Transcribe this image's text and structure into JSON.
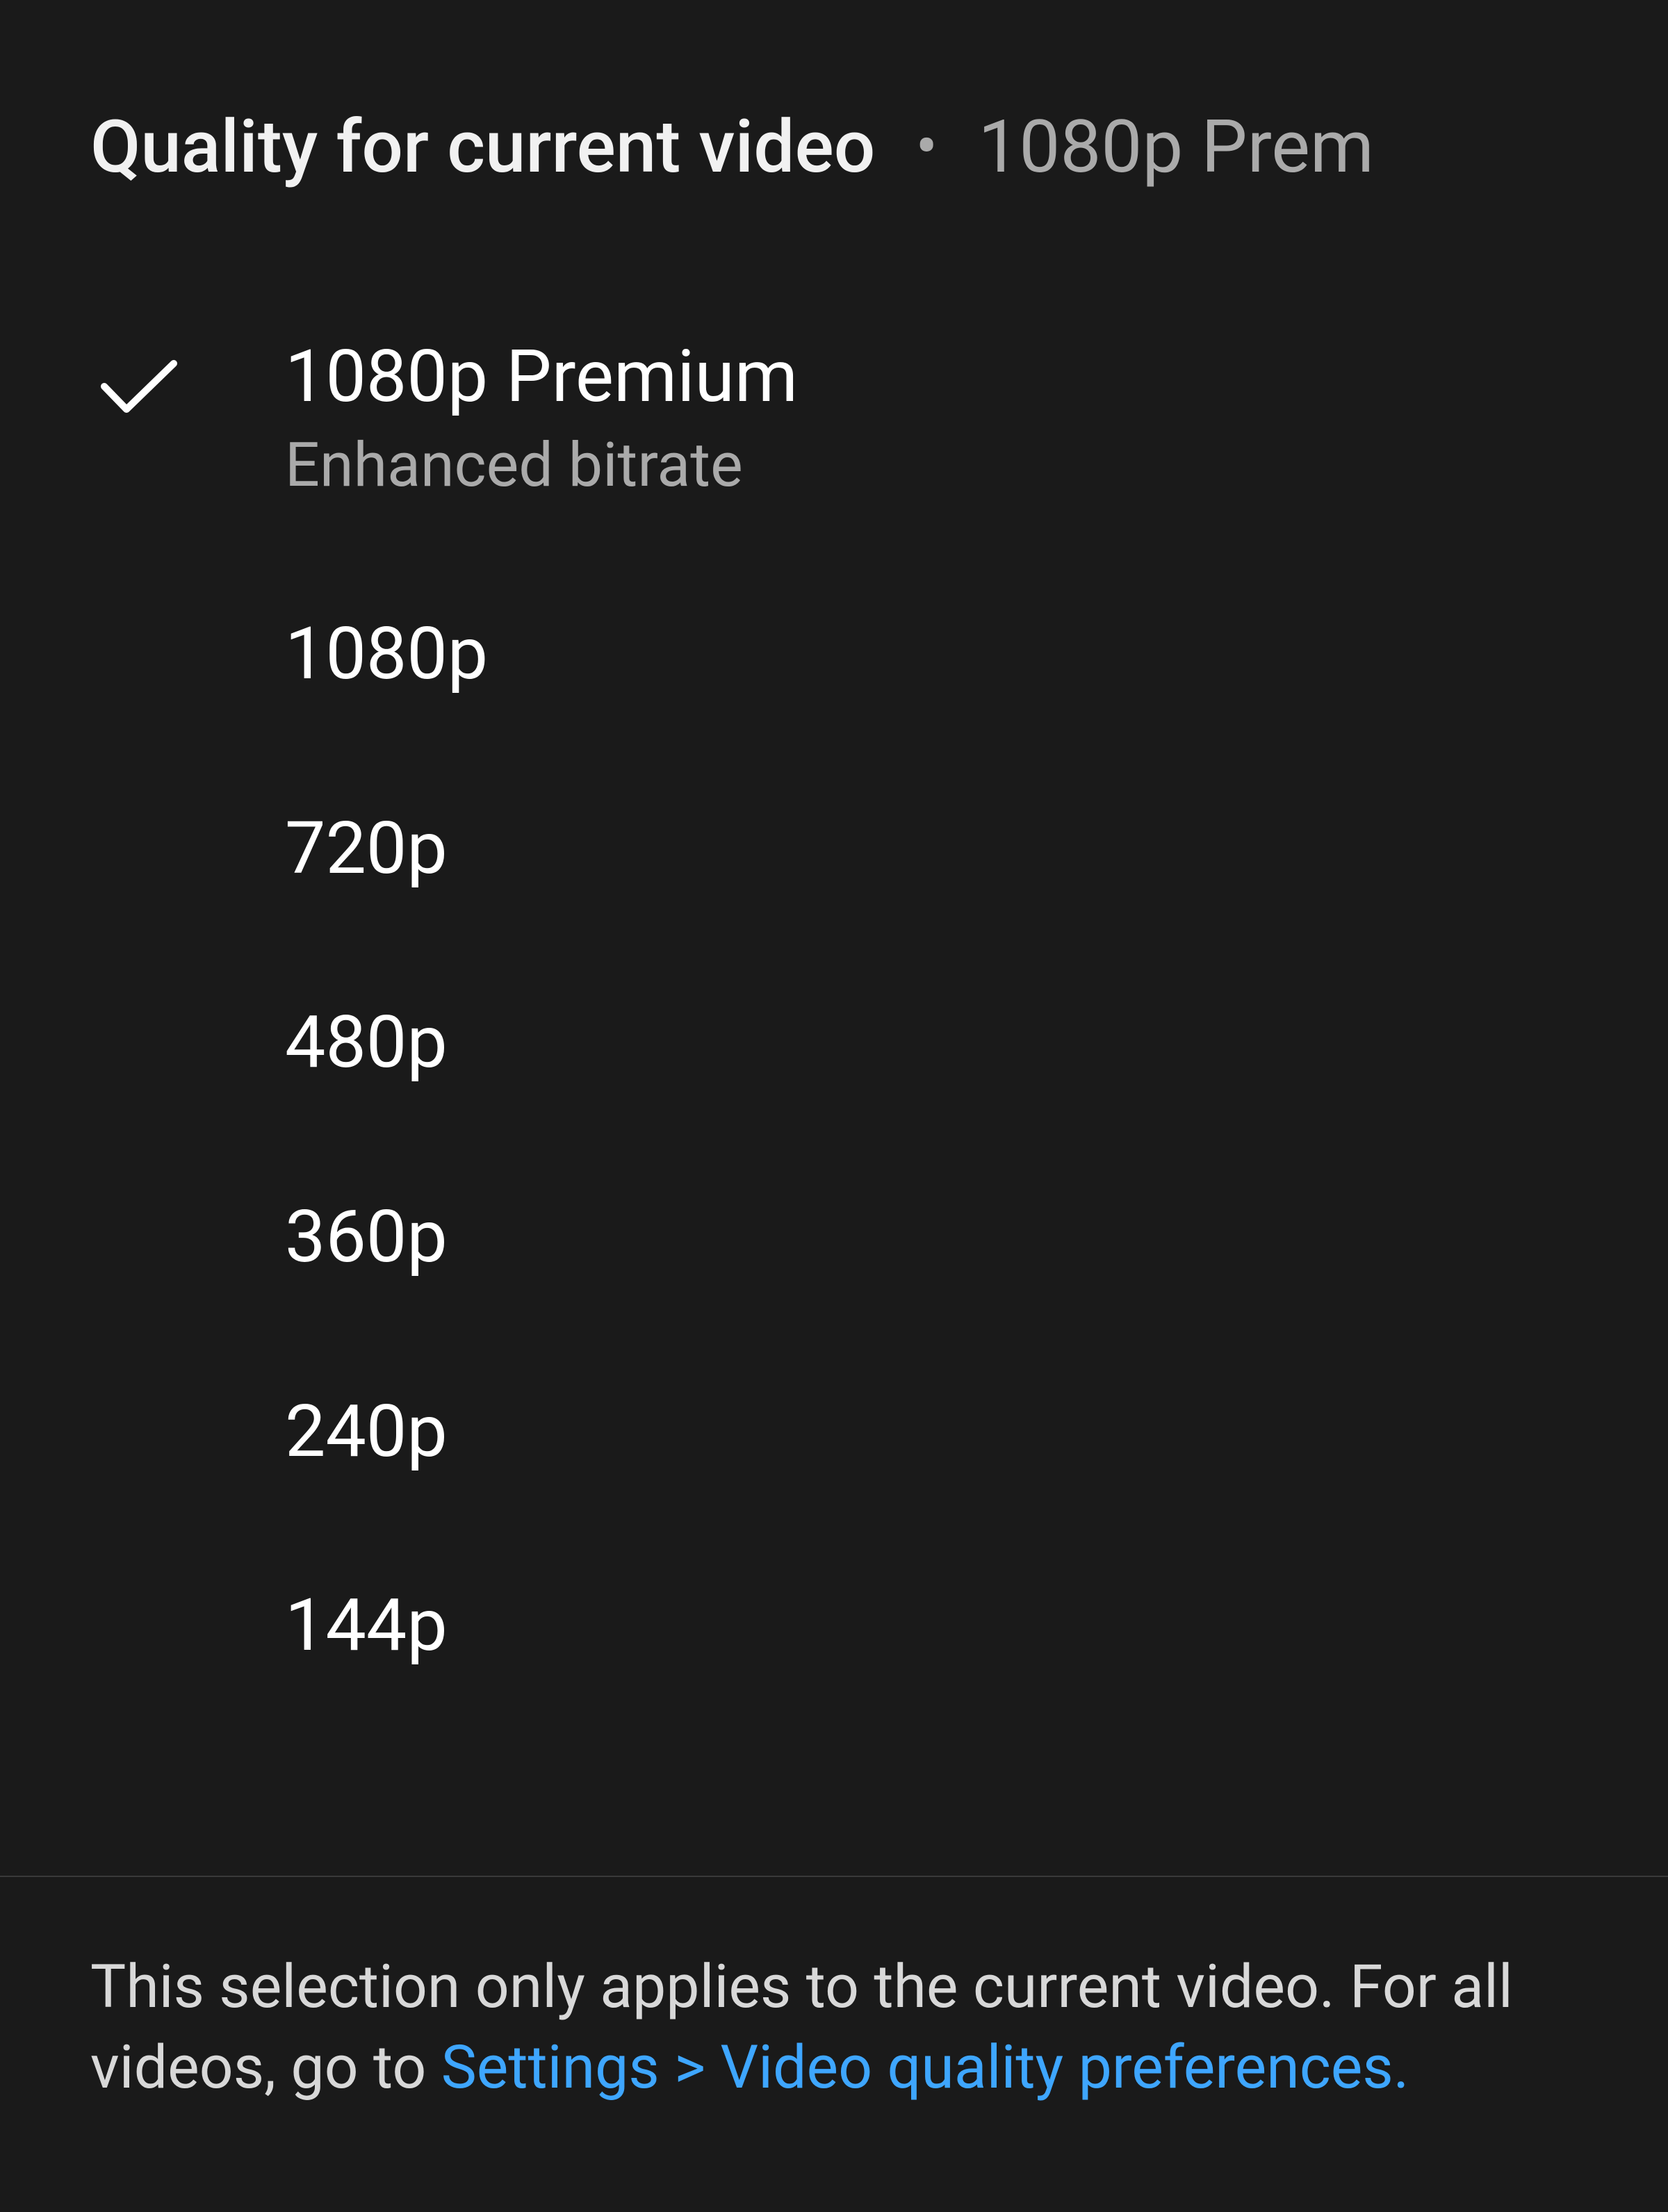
{
  "header": {
    "title": "Quality for current video",
    "separator": "•",
    "current": "1080p Prem"
  },
  "options": [
    {
      "label": "1080p Premium",
      "sublabel": "Enhanced bitrate",
      "selected": true
    },
    {
      "label": "1080p",
      "sublabel": "",
      "selected": false
    },
    {
      "label": "720p",
      "sublabel": "",
      "selected": false
    },
    {
      "label": "480p",
      "sublabel": "",
      "selected": false
    },
    {
      "label": "360p",
      "sublabel": "",
      "selected": false
    },
    {
      "label": "240p",
      "sublabel": "",
      "selected": false
    },
    {
      "label": "144p",
      "sublabel": "",
      "selected": false
    }
  ],
  "footer": {
    "text_before": "This selection only applies to the current video. For all videos, go to ",
    "link_text": "Settings > Video quality preferences."
  }
}
